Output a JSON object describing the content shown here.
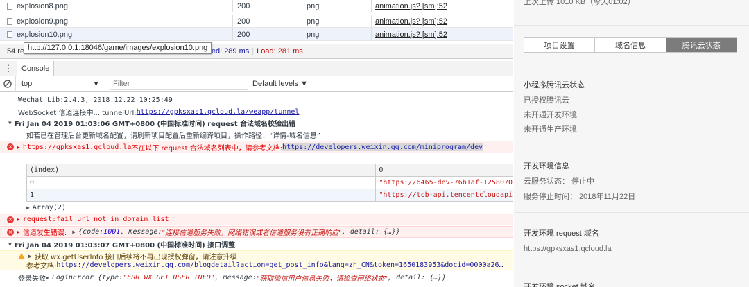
{
  "network": {
    "rows": [
      {
        "name": "explosion8.png",
        "status": "200",
        "type": "png",
        "initiator": "animation.js? [sm]:52"
      },
      {
        "name": "explosion9.png",
        "status": "200",
        "type": "png",
        "initiator": "animation.js? [sm]:52"
      },
      {
        "name": "explosion10.png",
        "status": "200",
        "type": "png",
        "initiator": "animation.js? [sm]:52"
      }
    ],
    "status_prefix": "54 re",
    "dom_content_loaded": "entLoaded: 289 ms",
    "separator": "|",
    "load": "Load: 281 ms",
    "tooltip_url": "http://127.0.0.1:18046/game/images/explosion10.png"
  },
  "drawer": {
    "menu_glyph": "⋮",
    "console_tab": "Console"
  },
  "console_toolbar": {
    "context": "top",
    "context_arrow": "▼",
    "filter_placeholder": "Filter",
    "levels": "Default levels ▼"
  },
  "console": {
    "lib_line": "Wechat Lib:2.4.3, 2018.12.22 10:25:49",
    "ws_prefix": "WebSocket 信道连接中...   tunnelUrl: ",
    "ws_url": "https://gpksxas1.qcloud.la/weapp/tunnel",
    "group1_header": "Fri Jan 04 2019 01:03:06 GMT+0800 (中国标准时间) request 合法域名校验出错",
    "group1_note": "如若已在管理后台更新域名配置，请刷新项目配置后重新编译项目，操作路径：“详情-域名信息”",
    "err1_url": "https://gpksxas1.qcloud.la",
    "err1_text": " 不在以下 request 合法域名列表中，请参考文档: ",
    "err1_doc": "https://developers.weixin.qq.com/miniprogram/dev",
    "table_headers": [
      "(index)",
      "0"
    ],
    "table_rows": [
      {
        "index": "0",
        "value": "\"https://6465-dev-76b1af-1258070"
      },
      {
        "index": "1",
        "value": "\"https://tcb-api.tencentcloudapi"
      }
    ],
    "array_label": "Array(2)",
    "err2_text": "request:fail url not in domain list",
    "err3_label": "信道发生错误:",
    "err3_code_key": "code: ",
    "err3_code": "1001",
    "err3_msg_key": ", message: ",
    "err3_msg": "\"连接信道服务失败，网络错误或者信道服务没有正确响应\"",
    "err3_tail": ", detail: {…}}",
    "group2_header": "Fri Jan 04 2019 01:03:07 GMT+0800 (中国标准时间) 接口调整",
    "warn_line1": "获取 wx.getUserInfo 接口后续将不再出现授权弹窗，请注意升级",
    "warn_line2_prefix": "参考文档: ",
    "warn_line2_url": "https://developers.weixin.qq.com/blogdetail?action=get_post_info&lang=zh_CN&token=1650183953&docid=0000a26…",
    "login_prefix": "登录失败 ",
    "login_error": "LoginError {type: ",
    "login_type": "\"ERR_WX_GET_USER_INFO\"",
    "login_msg_key": ", message: ",
    "login_msg": "\"获取微信用户信息失败，请检查网络状态\"",
    "login_tail": ", detail: {…}}"
  },
  "panel": {
    "top_text": "上次上传    1010 KB（今天01:02）",
    "tabs": [
      "项目设置",
      "域名信息",
      "腾讯云状态"
    ],
    "cloud_title": "小程序腾讯云状态",
    "cloud_items": [
      "已授权腾讯云",
      "未开通开发环境",
      "未开通生产环境"
    ],
    "dev_title": "开发环境信息",
    "dev_status": "云服务状态： 停止中",
    "dev_stop_time": "服务停止时间： 2018年11月22日",
    "req_title": "开发环境 request 域名",
    "req_domain": "https://gpksxas1.qcloud.la",
    "socket_title": "开发环境 socket 域名"
  }
}
